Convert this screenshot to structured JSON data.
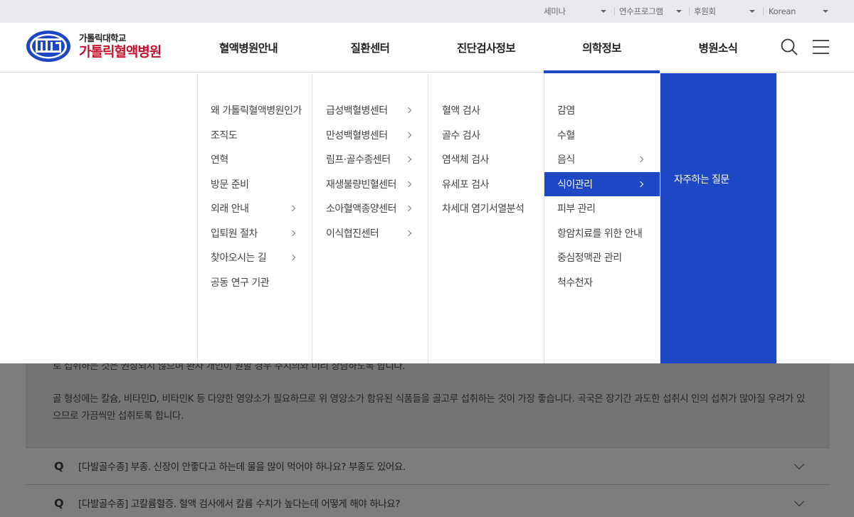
{
  "topbar": {
    "seminar": "세미나",
    "training": "연수프로그램",
    "sponsor": "후원회",
    "language": "Korean"
  },
  "logo": {
    "university": "가톨릭대학교",
    "hospital": "가톨릭혈액병원",
    "emblem_text": "CATHOLIC UNIVERSITY OF KOREA",
    "brand_color": "#c8102e"
  },
  "gnb": [
    "혈액병원안내",
    "질환센터",
    "진단검사정보",
    "의학정보",
    "병원소식"
  ],
  "accent_color": "#1d47c3",
  "mega": {
    "col1": [
      {
        "label": "왜 가톨릭혈액병원인가",
        "arrow": false
      },
      {
        "label": "조직도",
        "arrow": false
      },
      {
        "label": "연혁",
        "arrow": false
      },
      {
        "label": "방문 준비",
        "arrow": false
      },
      {
        "label": "외래 안내",
        "arrow": true
      },
      {
        "label": "입퇴원 절차",
        "arrow": true
      },
      {
        "label": "찾아오시는 길",
        "arrow": true
      },
      {
        "label": "공동 연구 기관",
        "arrow": false
      }
    ],
    "col2": [
      {
        "label": "급성백혈병센터",
        "arrow": true
      },
      {
        "label": "만성백혈병센터",
        "arrow": true
      },
      {
        "label": "림프·골수종센터",
        "arrow": true
      },
      {
        "label": "재생불량빈혈센터",
        "arrow": true
      },
      {
        "label": "소아혈액종양센터",
        "arrow": true
      },
      {
        "label": "이식협진센터",
        "arrow": true
      }
    ],
    "col3": [
      {
        "label": "혈액 검사",
        "arrow": false
      },
      {
        "label": "골수 검사",
        "arrow": false
      },
      {
        "label": "염색체 검사",
        "arrow": false
      },
      {
        "label": "유세포 검사",
        "arrow": false
      },
      {
        "label": "차세대 염기서열분석",
        "arrow": false
      }
    ],
    "col4": [
      {
        "label": "감염",
        "arrow": false
      },
      {
        "label": "수혈",
        "arrow": false
      },
      {
        "label": "음식",
        "arrow": true
      },
      {
        "label": "식이관리",
        "arrow": true,
        "selected": true
      },
      {
        "label": "피부 관리",
        "arrow": false
      },
      {
        "label": "항암치료를 위한 안내",
        "arrow": false
      },
      {
        "label": "중심정맥관 관리",
        "arrow": false
      },
      {
        "label": "척수천자",
        "arrow": false
      }
    ],
    "sub": [
      "자주하는 질문"
    ]
  },
  "content": {
    "answer_line1": "로 섭취하는 것은 권장되지 않으며 환자 개인이 원할 경우 주치의와 미리 상담하도록 합니다.",
    "answer_line2": "골 형성에는 칼슘, 비타민D, 비타민K 등 다양한 영양소가 필요하므로 위 영양소가 함유된 식품들을 골고루 섭취하는 것이 가장 좋습니다. 곡국은 장기간 과도한 섭취시 인의 섭취가 많아질 우려가 있으므로 가끔씩만 섭취토록 합니다.",
    "faq": [
      {
        "q": "Q",
        "text": "[다발골수종] 부종. 신장이 안좋다고 하는데 물을 많이 먹어야 하나요? 부종도 있어요."
      },
      {
        "q": "Q",
        "text": "[다발골수종] 고칼륨혈증. 혈액 검사에서 칼륨 수치가 높다는데 어떻게 해야 하나요?"
      }
    ]
  }
}
